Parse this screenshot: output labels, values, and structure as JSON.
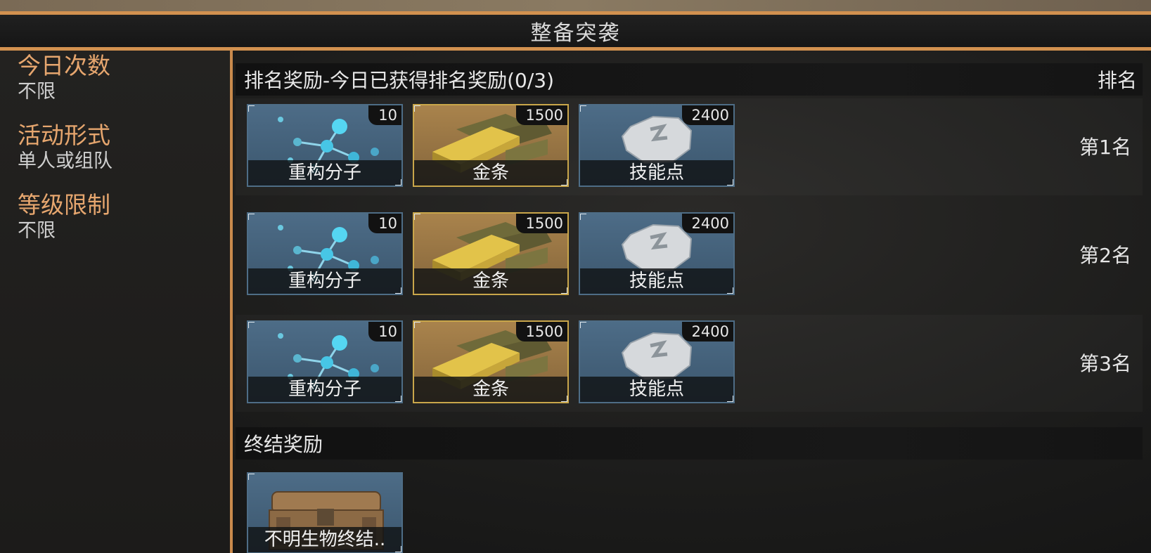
{
  "title": "整备突袭",
  "sidebar": {
    "items": [
      {
        "label": "今日次数",
        "value": "不限"
      },
      {
        "label": "活动形式",
        "value": "单人或组队"
      },
      {
        "label": "等级限制",
        "value": "不限"
      }
    ]
  },
  "ranking": {
    "header": "排名奖励-今日已获得排名奖励(0/3)",
    "rank_column": "排名",
    "rows": [
      {
        "rank": "第1名",
        "items": [
          {
            "name": "重构分子",
            "count": "10",
            "icon": "molecule-icon"
          },
          {
            "name": "金条",
            "count": "1500",
            "icon": "gold-bar-icon"
          },
          {
            "name": "技能点",
            "count": "2400",
            "icon": "skill-point-icon"
          }
        ]
      },
      {
        "rank": "第2名",
        "items": [
          {
            "name": "重构分子",
            "count": "10",
            "icon": "molecule-icon"
          },
          {
            "name": "金条",
            "count": "1500",
            "icon": "gold-bar-icon"
          },
          {
            "name": "技能点",
            "count": "2400",
            "icon": "skill-point-icon"
          }
        ]
      },
      {
        "rank": "第3名",
        "items": [
          {
            "name": "重构分子",
            "count": "10",
            "icon": "molecule-icon"
          },
          {
            "name": "金条",
            "count": "1500",
            "icon": "gold-bar-icon"
          },
          {
            "name": "技能点",
            "count": "2400",
            "icon": "skill-point-icon"
          }
        ]
      }
    ]
  },
  "final_reward": {
    "header": "终结奖励",
    "items": [
      {
        "name": "不明生物终结..",
        "icon": "treasure-chest-icon"
      }
    ]
  },
  "colors": {
    "accent": "#d2914f",
    "label": "#e6a66e",
    "item_blue": "#4d6c87",
    "item_gold": "#a9834c"
  }
}
